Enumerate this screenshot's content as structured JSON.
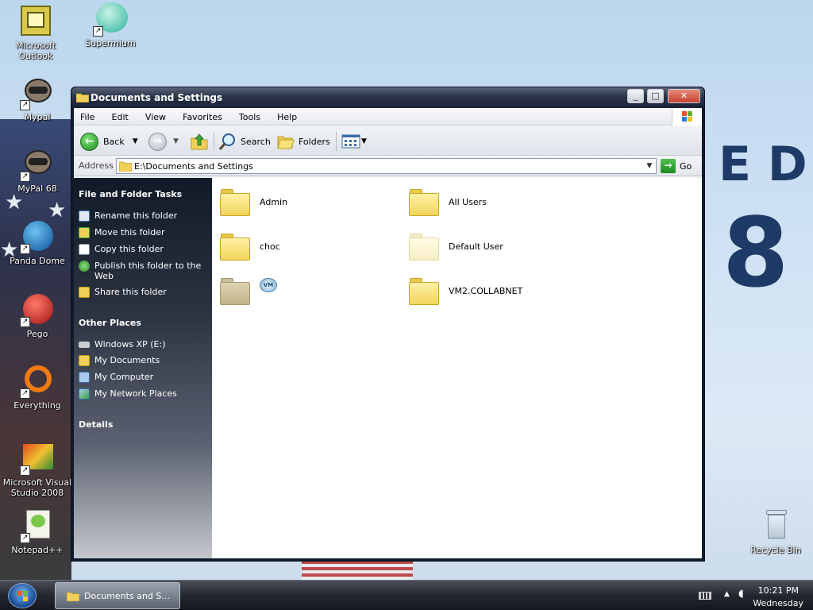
{
  "desktop": {
    "icons": [
      {
        "label": "Microsoft Outlook",
        "shortcut": false
      },
      {
        "label": "Supermium",
        "shortcut": true
      },
      {
        "label": "Mypal",
        "shortcut": true
      },
      {
        "label": "MyPal 68",
        "shortcut": true
      },
      {
        "label": "Panda Dome",
        "shortcut": true
      },
      {
        "label": "Pego",
        "shortcut": true
      },
      {
        "label": "Everything",
        "shortcut": true
      },
      {
        "label": "Microsoft Visual Studio 2008",
        "shortcut": true
      },
      {
        "label": "Notepad++",
        "shortcut": true
      },
      {
        "label": "Recycle Bin",
        "shortcut": false
      }
    ],
    "wallpaper_letters": [
      "E D",
      "8"
    ]
  },
  "window": {
    "title": "Documents and Settings",
    "controls": {
      "minimize": "_",
      "maximize": "□",
      "close": "✕"
    },
    "menu": [
      "File",
      "Edit",
      "View",
      "Favorites",
      "Tools",
      "Help"
    ],
    "toolbar": {
      "back": "Back",
      "search": "Search",
      "folders": "Folders"
    },
    "address": {
      "label": "Address",
      "value": "E:\\Documents and Settings",
      "go": "Go"
    },
    "taskpane": {
      "file_tasks": {
        "title": "File and Folder Tasks",
        "items": [
          "Rename this folder",
          "Move this folder",
          "Copy this folder",
          "Publish this folder to the Web",
          "Share this folder"
        ]
      },
      "other_places": {
        "title": "Other Places",
        "items": [
          "Windows XP (E:)",
          "My Documents",
          "My Computer",
          "My Network Places"
        ]
      },
      "details": {
        "title": "Details"
      }
    },
    "files": [
      {
        "name": "Admin",
        "style": "normal"
      },
      {
        "name": "All Users",
        "style": "normal"
      },
      {
        "name": "choc",
        "style": "normal"
      },
      {
        "name": "Default User",
        "style": "pale"
      },
      {
        "name": "",
        "style": "grey",
        "badge": "VM"
      },
      {
        "name": "VM2.COLLABNET",
        "style": "normal"
      }
    ]
  },
  "taskbar": {
    "task_label": "Documents and S...",
    "clock_time": "10:21 PM",
    "clock_day": "Wednesday"
  }
}
